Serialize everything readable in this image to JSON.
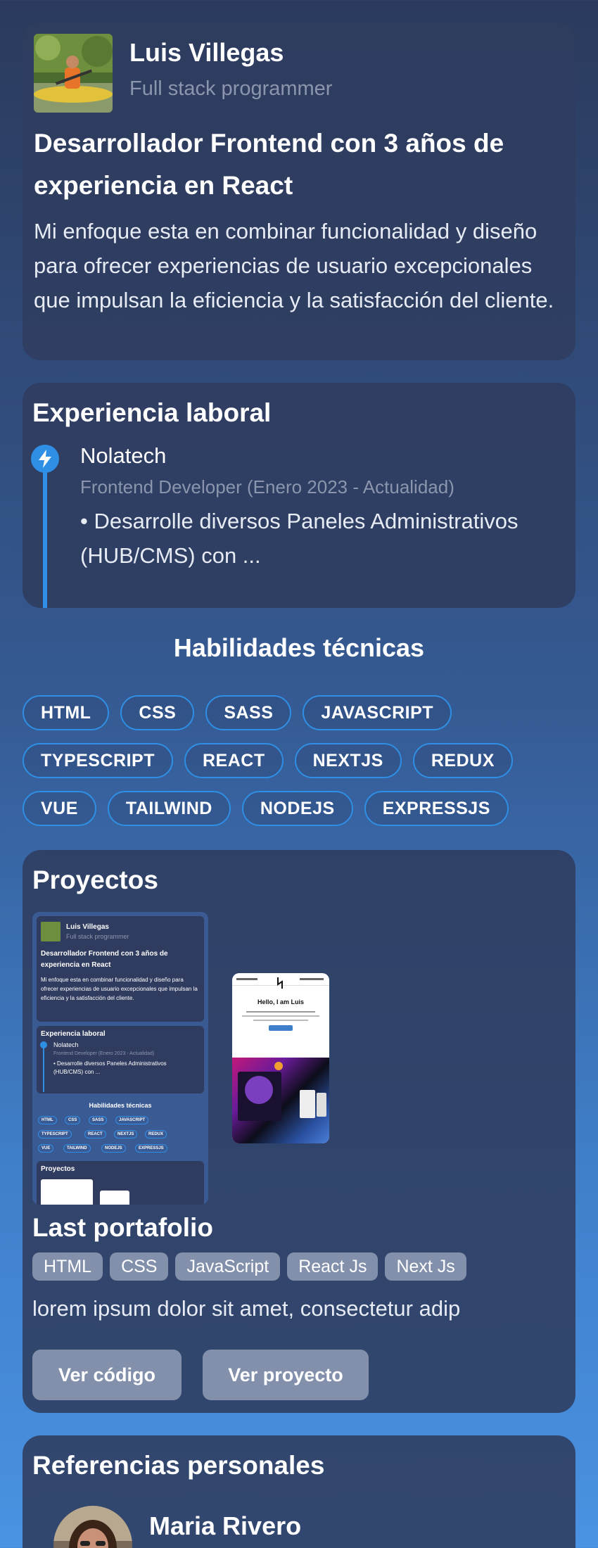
{
  "profile": {
    "name": "Luis Villegas",
    "role": "Full stack programmer",
    "headline": "Desarrollador Frontend con 3 años de experiencia en React",
    "bio": "Mi enfoque esta en combinar funcionalidad y diseño para ofrecer experiencias de usuario excepcionales que impulsan la eficiencia y la satisfacción del cliente."
  },
  "experience": {
    "title": "Experiencia laboral",
    "icon": "lightning-icon",
    "items": [
      {
        "company": "Nolatech",
        "position": "Frontend Developer (Enero 2023 - Actualidad)",
        "description": "• Desarrolle diversos Paneles Administrativos (HUB/CMS) con ..."
      }
    ]
  },
  "skills": {
    "title": "Habilidades técnicas",
    "items": [
      "HTML",
      "CSS",
      "SASS",
      "JAVASCRIPT",
      "TYPESCRIPT",
      "REACT",
      "NEXTJS",
      "REDUX",
      "VUE",
      "TAILWIND",
      "NODEJS",
      "EXPRESSJS"
    ]
  },
  "projects": {
    "title": "Proyectos",
    "items": [
      {
        "name": "Last portafolio",
        "tags": [
          "HTML",
          "CSS",
          "JavaScript",
          "React Js",
          "Next Js"
        ],
        "description": "lorem ipsum dolor sit amet, consectetur adip",
        "code_label": "Ver código",
        "demo_label": "Ver proyecto",
        "preview_hero": "Hello, I am Luis"
      }
    ]
  },
  "references": {
    "title": "Referencias personales",
    "items": [
      {
        "name": "Maria Rivero"
      }
    ]
  },
  "colors": {
    "accent": "#2f8fe5",
    "card": "#2f3c5f",
    "muted_text": "#8b95ad",
    "tag_bg": "#8290ab"
  }
}
